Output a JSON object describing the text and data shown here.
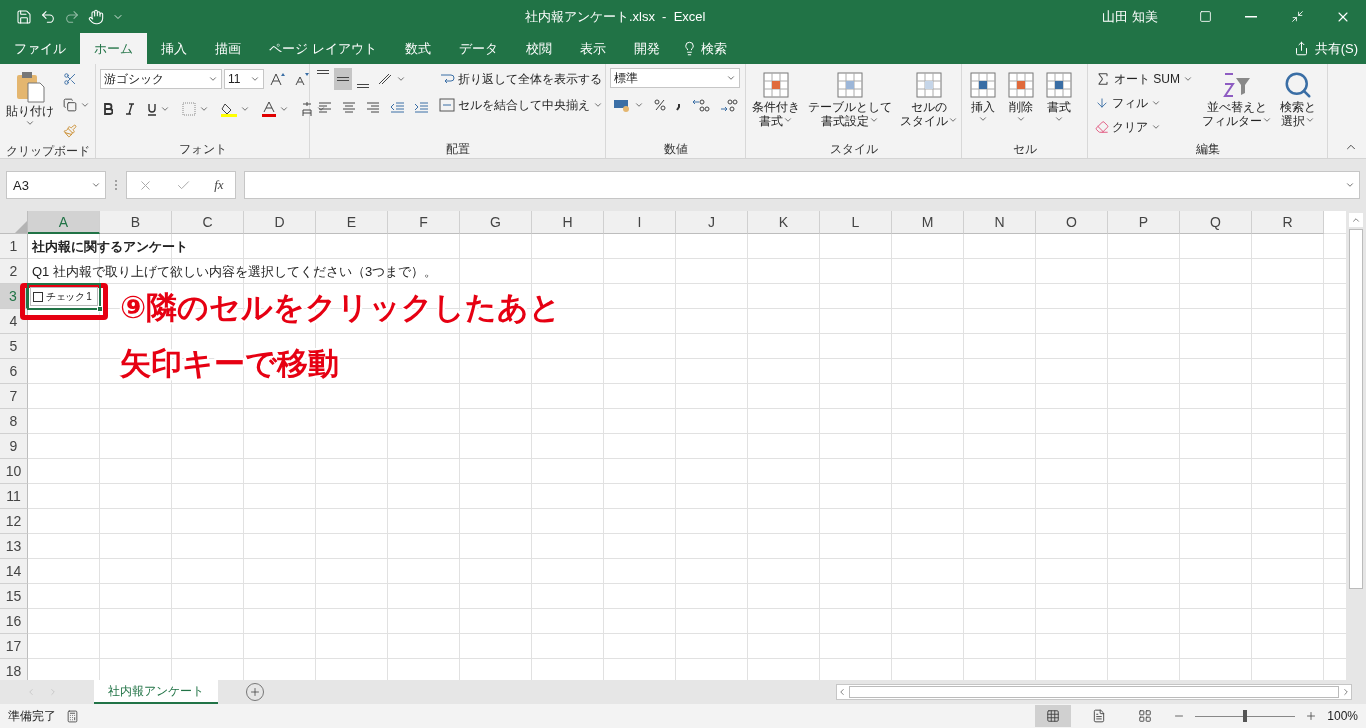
{
  "title_bar": {
    "title": "社内報アンケート.xlsx  -  Excel",
    "user": "山田 知美"
  },
  "menu_tabs": [
    {
      "label": "ファイル",
      "selected": false
    },
    {
      "label": "ホーム",
      "selected": true
    },
    {
      "label": "挿入",
      "selected": false
    },
    {
      "label": "描画",
      "selected": false
    },
    {
      "label": "ページ レイアウト",
      "selected": false
    },
    {
      "label": "数式",
      "selected": false
    },
    {
      "label": "データ",
      "selected": false
    },
    {
      "label": "校閲",
      "selected": false
    },
    {
      "label": "表示",
      "selected": false
    },
    {
      "label": "開発",
      "selected": false
    }
  ],
  "tell_me": "検索",
  "share": "共有(S)",
  "ribbon": {
    "clipboard": {
      "paste": "貼り付け",
      "label": "クリップボード"
    },
    "font": {
      "name": "游ゴシック",
      "size": "11",
      "label": "フォント"
    },
    "alignment": {
      "vertical": [
        {
          "selected": false
        },
        {
          "selected": true
        },
        {
          "selected": false
        }
      ],
      "wrap_text": "折り返して全体を表示する",
      "merge_center": "セルを結合して中央揃え",
      "label": "配置"
    },
    "number": {
      "format": "標準",
      "label": "数値"
    },
    "styles": {
      "buttons": [
        {
          "lines": [
            "条件付き",
            "書式"
          ]
        },
        {
          "lines": [
            "テーブルとして",
            "書式設定"
          ]
        },
        {
          "lines": [
            "セルの",
            "スタイル"
          ]
        }
      ],
      "label": "スタイル"
    },
    "cells": {
      "buttons": [
        "挿入",
        "削除",
        "書式"
      ],
      "label": "セル"
    },
    "editing": {
      "autosum": "オート SUM",
      "fill": "フィル",
      "clear": "クリア",
      "sort_filter": [
        "並べ替えと",
        "フィルター"
      ],
      "find_select": [
        "検索と",
        "選択"
      ],
      "label": "編集"
    }
  },
  "formula_bar": {
    "name_box": "A3",
    "function_label": "fx"
  },
  "sheet": {
    "columns": [
      {
        "label": "A",
        "selected": true
      },
      {
        "label": "B",
        "selected": false
      },
      {
        "label": "C",
        "selected": false
      },
      {
        "label": "D",
        "selected": false
      },
      {
        "label": "E",
        "selected": false
      },
      {
        "label": "F",
        "selected": false
      },
      {
        "label": "G",
        "selected": false
      },
      {
        "label": "H",
        "selected": false
      },
      {
        "label": "I",
        "selected": false
      },
      {
        "label": "J",
        "selected": false
      },
      {
        "label": "K",
        "selected": false
      },
      {
        "label": "L",
        "selected": false
      },
      {
        "label": "M",
        "selected": false
      },
      {
        "label": "N",
        "selected": false
      },
      {
        "label": "O",
        "selected": false
      },
      {
        "label": "P",
        "selected": false
      },
      {
        "label": "Q",
        "selected": false
      },
      {
        "label": "R",
        "selected": false
      }
    ],
    "rows": [
      {
        "label": "1",
        "selected": false,
        "cells": [
          {
            "kind": "text",
            "text": "社内報に関するアンケート",
            "bold": true,
            "selected": false
          }
        ]
      },
      {
        "label": "2",
        "selected": false,
        "cells": [
          {
            "kind": "text",
            "text": "Q1 社内報で取り上げて欲しい内容を選択してください（3つまで）。",
            "bold": false,
            "selected": false
          }
        ]
      },
      {
        "label": "3",
        "selected": true,
        "cells": [
          {
            "kind": "checkbox",
            "text": "チェック 1",
            "checked": false,
            "selected": true
          }
        ]
      },
      {
        "label": "4",
        "selected": false
      },
      {
        "label": "5",
        "selected": false
      },
      {
        "label": "6",
        "selected": false
      },
      {
        "label": "7",
        "selected": false
      },
      {
        "label": "8",
        "selected": false
      },
      {
        "label": "9",
        "selected": false
      },
      {
        "label": "10",
        "selected": false
      },
      {
        "label": "11",
        "selected": false
      },
      {
        "label": "12",
        "selected": false
      },
      {
        "label": "13",
        "selected": false
      },
      {
        "label": "14",
        "selected": false
      },
      {
        "label": "15",
        "selected": false
      },
      {
        "label": "16",
        "selected": false
      },
      {
        "label": "17",
        "selected": false
      },
      {
        "label": "18",
        "selected": false
      }
    ]
  },
  "annotation": {
    "lines": [
      "⑨隣のセルをクリックしたあと",
      "矢印キーで移動"
    ]
  },
  "sheet_tabs": [
    {
      "label": "社内報アンケート",
      "selected": true
    }
  ],
  "status_bar": {
    "status": "準備完了",
    "views": [
      {
        "kind": "normal",
        "selected": true
      },
      {
        "kind": "page_layout",
        "selected": false
      },
      {
        "kind": "page_break",
        "selected": false
      }
    ],
    "zoom_slider": {
      "level": 0.5
    },
    "zoom": "100%"
  }
}
